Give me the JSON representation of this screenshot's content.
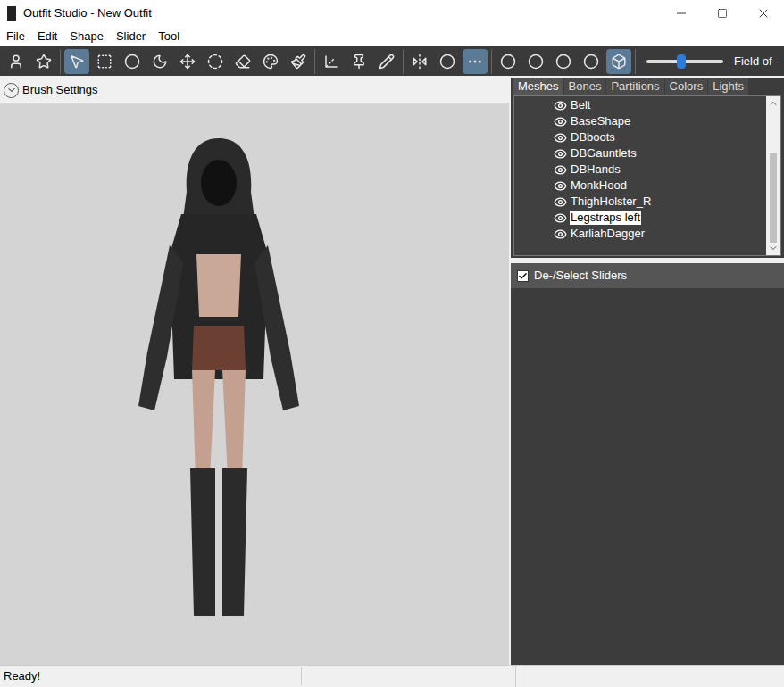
{
  "window": {
    "title": "Outfit Studio - New Outfit",
    "controls": [
      "minimize",
      "maximize",
      "close"
    ]
  },
  "menu": [
    "File",
    "Edit",
    "Shape",
    "Slider",
    "Tool"
  ],
  "toolbar": {
    "groups": [
      [
        {
          "tool": "load-project",
          "selected": false
        },
        {
          "tool": "load-outfit",
          "selected": false
        }
      ],
      [
        {
          "tool": "select",
          "selected": true
        },
        {
          "tool": "mask",
          "selected": false
        },
        {
          "tool": "inflate",
          "selected": false
        },
        {
          "tool": "deflate",
          "selected": false
        },
        {
          "tool": "move",
          "selected": false
        },
        {
          "tool": "smooth",
          "selected": false
        },
        {
          "tool": "undiff",
          "selected": false
        },
        {
          "tool": "colors",
          "selected": false
        },
        {
          "tool": "paint",
          "selected": false
        }
      ],
      [
        {
          "tool": "transform",
          "selected": false
        },
        {
          "tool": "pivot",
          "selected": false
        },
        {
          "tool": "weight",
          "selected": false
        }
      ],
      [
        {
          "tool": "mirror",
          "selected": false
        },
        {
          "tool": "connected",
          "selected": false
        },
        {
          "tool": "vertices",
          "selected": true
        }
      ],
      [
        {
          "tool": "size-small",
          "selected": false
        },
        {
          "tool": "size-medium",
          "selected": false
        },
        {
          "tool": "size-large",
          "selected": false
        },
        {
          "tool": "size-xlarge",
          "selected": false
        },
        {
          "tool": "cube",
          "selected": true
        }
      ]
    ],
    "fov": {
      "label": "Field of",
      "level": 0.45
    }
  },
  "brush_settings": {
    "label": "Brush Settings",
    "expanded": false
  },
  "tabs": [
    {
      "label": "Meshes",
      "selected": true
    },
    {
      "label": "Bones",
      "selected": false
    },
    {
      "label": "Partitions",
      "selected": false
    },
    {
      "label": "Colors",
      "selected": false
    },
    {
      "label": "Lights",
      "selected": false
    }
  ],
  "meshes": [
    {
      "name": "Belt",
      "visible": true,
      "selected": false
    },
    {
      "name": "BaseShape",
      "visible": true,
      "selected": false
    },
    {
      "name": "DBboots",
      "visible": true,
      "selected": false
    },
    {
      "name": "DBGauntlets",
      "visible": true,
      "selected": false
    },
    {
      "name": "DBHands",
      "visible": true,
      "selected": false
    },
    {
      "name": "MonkHood",
      "visible": true,
      "selected": false
    },
    {
      "name": "ThighHolster_R",
      "visible": true,
      "selected": false
    },
    {
      "name": "Legstraps left",
      "visible": true,
      "selected": true
    },
    {
      "name": "KarliahDagger",
      "visible": true,
      "selected": false
    }
  ],
  "sliders_header": {
    "label": "De-/Select Sliders",
    "checked": true
  },
  "status_bar": {
    "text": "Ready!"
  }
}
